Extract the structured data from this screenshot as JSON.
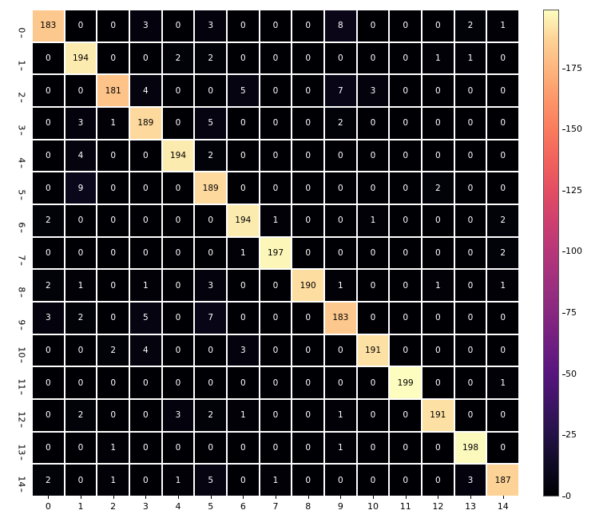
{
  "chart_data": {
    "type": "heatmap",
    "title": "",
    "xlabel": "",
    "ylabel": "",
    "x_categories": [
      "0",
      "1",
      "2",
      "3",
      "4",
      "5",
      "6",
      "7",
      "8",
      "9",
      "10",
      "11",
      "12",
      "13",
      "14"
    ],
    "y_categories": [
      "0",
      "1",
      "2",
      "3",
      "4",
      "5",
      "6",
      "7",
      "8",
      "9",
      "10",
      "11",
      "12",
      "13",
      "14"
    ],
    "values": [
      [
        183,
        0,
        0,
        3,
        0,
        3,
        0,
        0,
        0,
        8,
        0,
        0,
        0,
        2,
        1
      ],
      [
        0,
        194,
        0,
        0,
        2,
        2,
        0,
        0,
        0,
        0,
        0,
        0,
        1,
        1,
        0
      ],
      [
        0,
        0,
        181,
        4,
        0,
        0,
        5,
        0,
        0,
        7,
        3,
        0,
        0,
        0,
        0
      ],
      [
        0,
        3,
        1,
        189,
        0,
        5,
        0,
        0,
        0,
        2,
        0,
        0,
        0,
        0,
        0
      ],
      [
        0,
        4,
        0,
        0,
        194,
        2,
        0,
        0,
        0,
        0,
        0,
        0,
        0,
        0,
        0
      ],
      [
        0,
        9,
        0,
        0,
        0,
        189,
        0,
        0,
        0,
        0,
        0,
        0,
        2,
        0,
        0
      ],
      [
        2,
        0,
        0,
        0,
        0,
        0,
        194,
        1,
        0,
        0,
        1,
        0,
        0,
        0,
        2
      ],
      [
        0,
        0,
        0,
        0,
        0,
        0,
        1,
        197,
        0,
        0,
        0,
        0,
        0,
        0,
        2
      ],
      [
        2,
        1,
        0,
        1,
        0,
        3,
        0,
        0,
        190,
        1,
        0,
        0,
        1,
        0,
        1
      ],
      [
        3,
        2,
        0,
        5,
        0,
        7,
        0,
        0,
        0,
        183,
        0,
        0,
        0,
        0,
        0
      ],
      [
        0,
        0,
        2,
        4,
        0,
        0,
        3,
        0,
        0,
        0,
        191,
        0,
        0,
        0,
        0
      ],
      [
        0,
        0,
        0,
        0,
        0,
        0,
        0,
        0,
        0,
        0,
        0,
        199,
        0,
        0,
        1
      ],
      [
        0,
        2,
        0,
        0,
        3,
        2,
        1,
        0,
        0,
        1,
        0,
        0,
        191,
        0,
        0
      ],
      [
        0,
        0,
        1,
        0,
        0,
        0,
        0,
        0,
        0,
        1,
        0,
        0,
        0,
        198,
        0
      ],
      [
        2,
        0,
        1,
        0,
        1,
        5,
        0,
        1,
        0,
        0,
        0,
        0,
        0,
        3,
        187
      ]
    ],
    "colormap": "magma",
    "color_range": [
      0,
      199
    ],
    "colorbar_ticks": [
      0,
      25,
      50,
      75,
      100,
      125,
      150,
      175
    ]
  }
}
